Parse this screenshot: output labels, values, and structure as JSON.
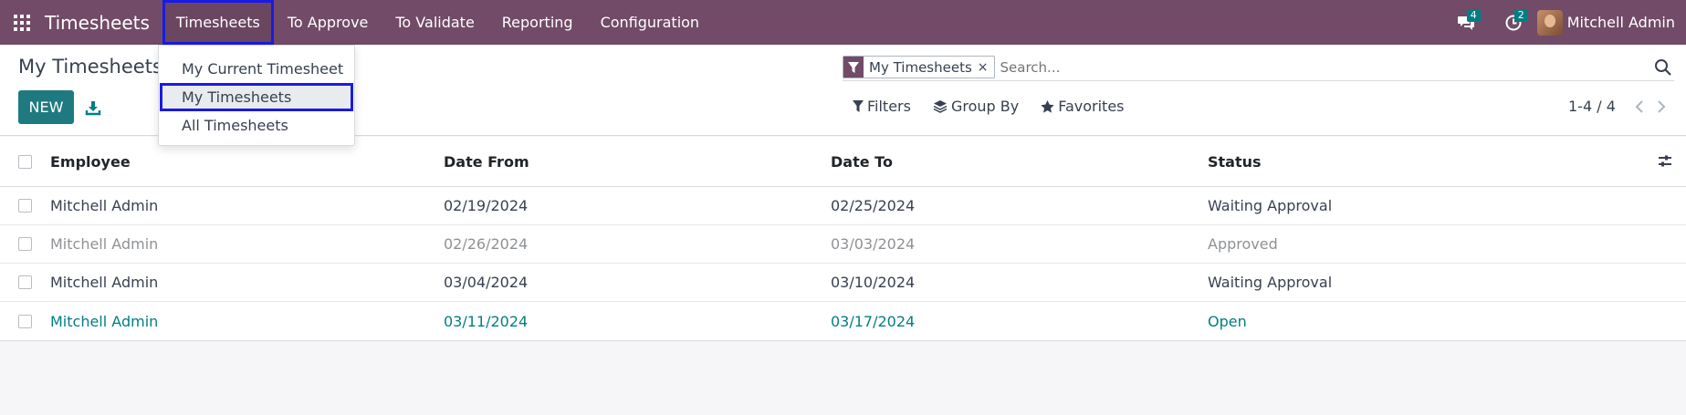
{
  "navbar": {
    "brand": "Timesheets",
    "menu": [
      "Timesheets",
      "To Approve",
      "To Validate",
      "Reporting",
      "Configuration"
    ],
    "messages_count": "4",
    "activities_count": "2",
    "user_name": "Mitchell Admin",
    "color": "#714b67"
  },
  "dropdown": {
    "items": [
      "My Current Timesheet",
      "My Timesheets",
      "All Timesheets"
    ]
  },
  "control_panel": {
    "title": "My Timesheets",
    "new_label": "NEW",
    "facet_label": "My Timesheets",
    "search_placeholder": "Search...",
    "filters_label": "Filters",
    "groupby_label": "Group By",
    "favorites_label": "Favorites",
    "pager": "1-4 / 4"
  },
  "table": {
    "columns": [
      "Employee",
      "Date From",
      "Date To",
      "Status"
    ],
    "rows": [
      [
        "Mitchell Admin",
        "02/19/2024",
        "02/25/2024",
        "Waiting Approval"
      ],
      [
        "Mitchell Admin",
        "02/26/2024",
        "03/03/2024",
        "Approved"
      ],
      [
        "Mitchell Admin",
        "03/04/2024",
        "03/10/2024",
        "Waiting Approval"
      ],
      [
        "Mitchell Admin",
        "03/11/2024",
        "03/17/2024",
        "Open"
      ]
    ]
  },
  "colors": {
    "accent": "#017e84",
    "primary_button": "#1f7a80",
    "highlight_outline": "#1a1ae6"
  }
}
